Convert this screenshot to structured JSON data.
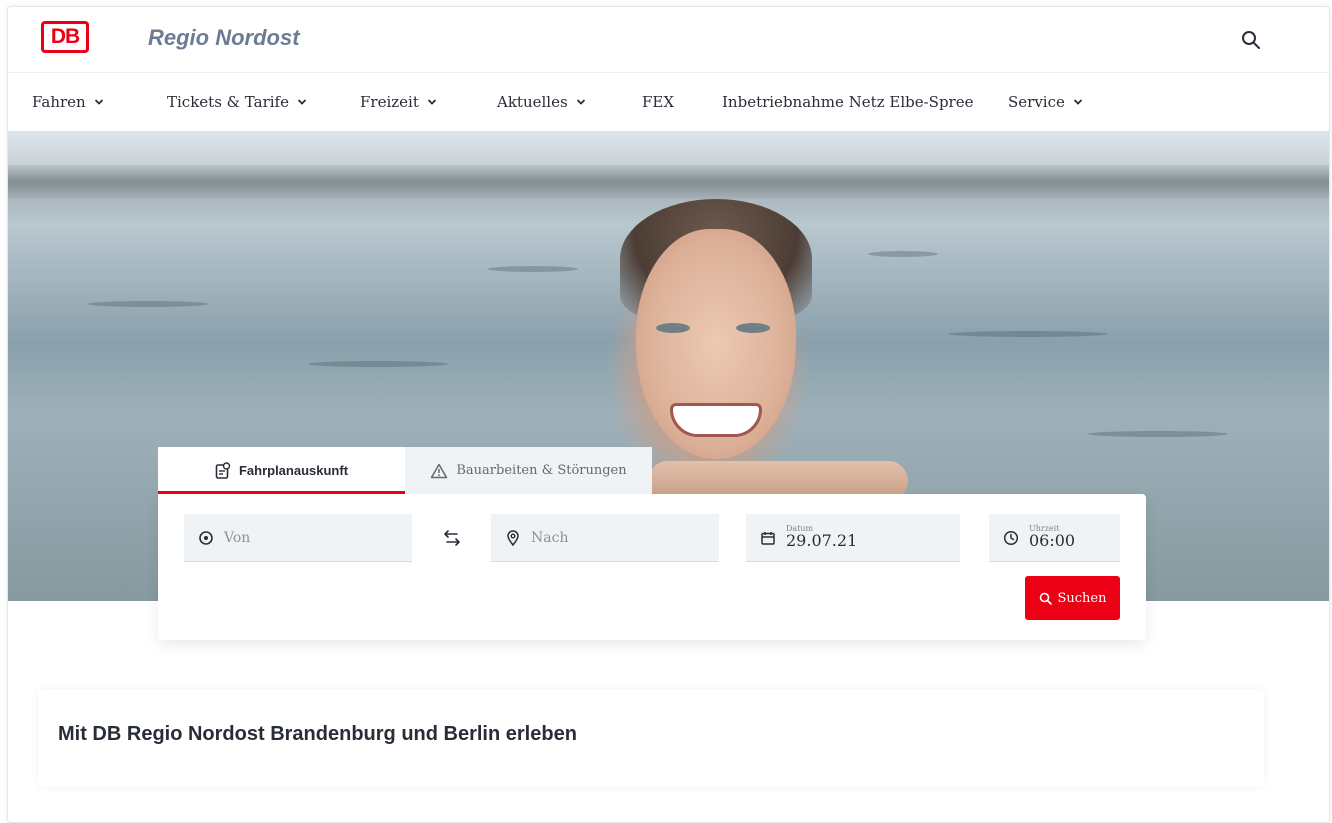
{
  "header": {
    "logo_text": "DB",
    "brand": "Regio Nordost"
  },
  "nav": {
    "items": [
      {
        "label": "Fahren",
        "has_dropdown": true
      },
      {
        "label": "Tickets & Tarife",
        "has_dropdown": true
      },
      {
        "label": "Freizeit",
        "has_dropdown": true
      },
      {
        "label": "Aktuelles",
        "has_dropdown": true
      },
      {
        "label": "FEX",
        "has_dropdown": false
      },
      {
        "label": "Inbetriebnahme Netz Elbe-Spree",
        "has_dropdown": false
      },
      {
        "label": "Service",
        "has_dropdown": true
      }
    ]
  },
  "search": {
    "tabs": [
      {
        "label": "Fahrplanauskunft",
        "icon": "timetable-icon",
        "active": true
      },
      {
        "label": "Bauarbeiten & Störungen",
        "icon": "warning-icon",
        "active": false
      }
    ],
    "from_placeholder": "Von",
    "to_placeholder": "Nach",
    "date_label": "Datum",
    "date_value": "29.07.21",
    "time_label": "Uhrzeit",
    "time_value": "06:00",
    "submit_label": "Suchen"
  },
  "content": {
    "heading": "Mit DB Regio Nordost Brandenburg und Berlin erleben"
  },
  "colors": {
    "accent": "#ec0016",
    "brand_text": "#6b7c93",
    "text": "#282d37",
    "field_bg": "#f0f3f5"
  }
}
